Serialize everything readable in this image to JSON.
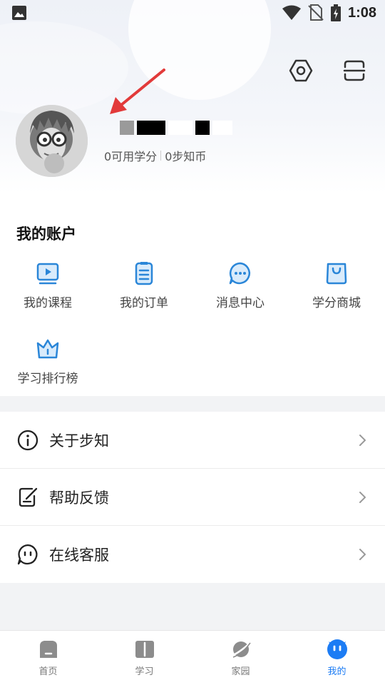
{
  "status_bar": {
    "time": "1:08",
    "icons": [
      "image-icon",
      "wifi-icon",
      "no-sim-icon",
      "battery-charging-icon"
    ]
  },
  "header": {
    "settings_icon": "settings-hex-icon",
    "scan_icon": "scan-icon",
    "user": {
      "credits_label": "0可用学分",
      "coins_label": "0步知币"
    }
  },
  "account": {
    "title": "我的账户",
    "items": [
      {
        "label": "我的课程",
        "icon": "course-video-icon"
      },
      {
        "label": "我的订单",
        "icon": "order-clipboard-icon"
      },
      {
        "label": "消息中心",
        "icon": "message-bubble-icon"
      },
      {
        "label": "学分商城",
        "icon": "shopping-bag-icon"
      },
      {
        "label": "学习排行榜",
        "icon": "crown-icon"
      }
    ]
  },
  "menu": [
    {
      "label": "关于步知",
      "icon": "info-icon"
    },
    {
      "label": "帮助反馈",
      "icon": "feedback-edit-icon"
    },
    {
      "label": "在线客服",
      "icon": "chat-service-icon"
    }
  ],
  "bottom_nav": {
    "items": [
      {
        "label": "首页",
        "icon": "home-icon",
        "active": false
      },
      {
        "label": "学习",
        "icon": "book-icon",
        "active": false
      },
      {
        "label": "家园",
        "icon": "planet-icon",
        "active": false
      },
      {
        "label": "我的",
        "icon": "profile-face-icon",
        "active": true
      }
    ]
  },
  "colors": {
    "accent": "#1c7cf4",
    "icon_blue": "#2a86d8",
    "arrow_red": "#e23a3a",
    "inactive_icon": "#8c8c8c"
  }
}
